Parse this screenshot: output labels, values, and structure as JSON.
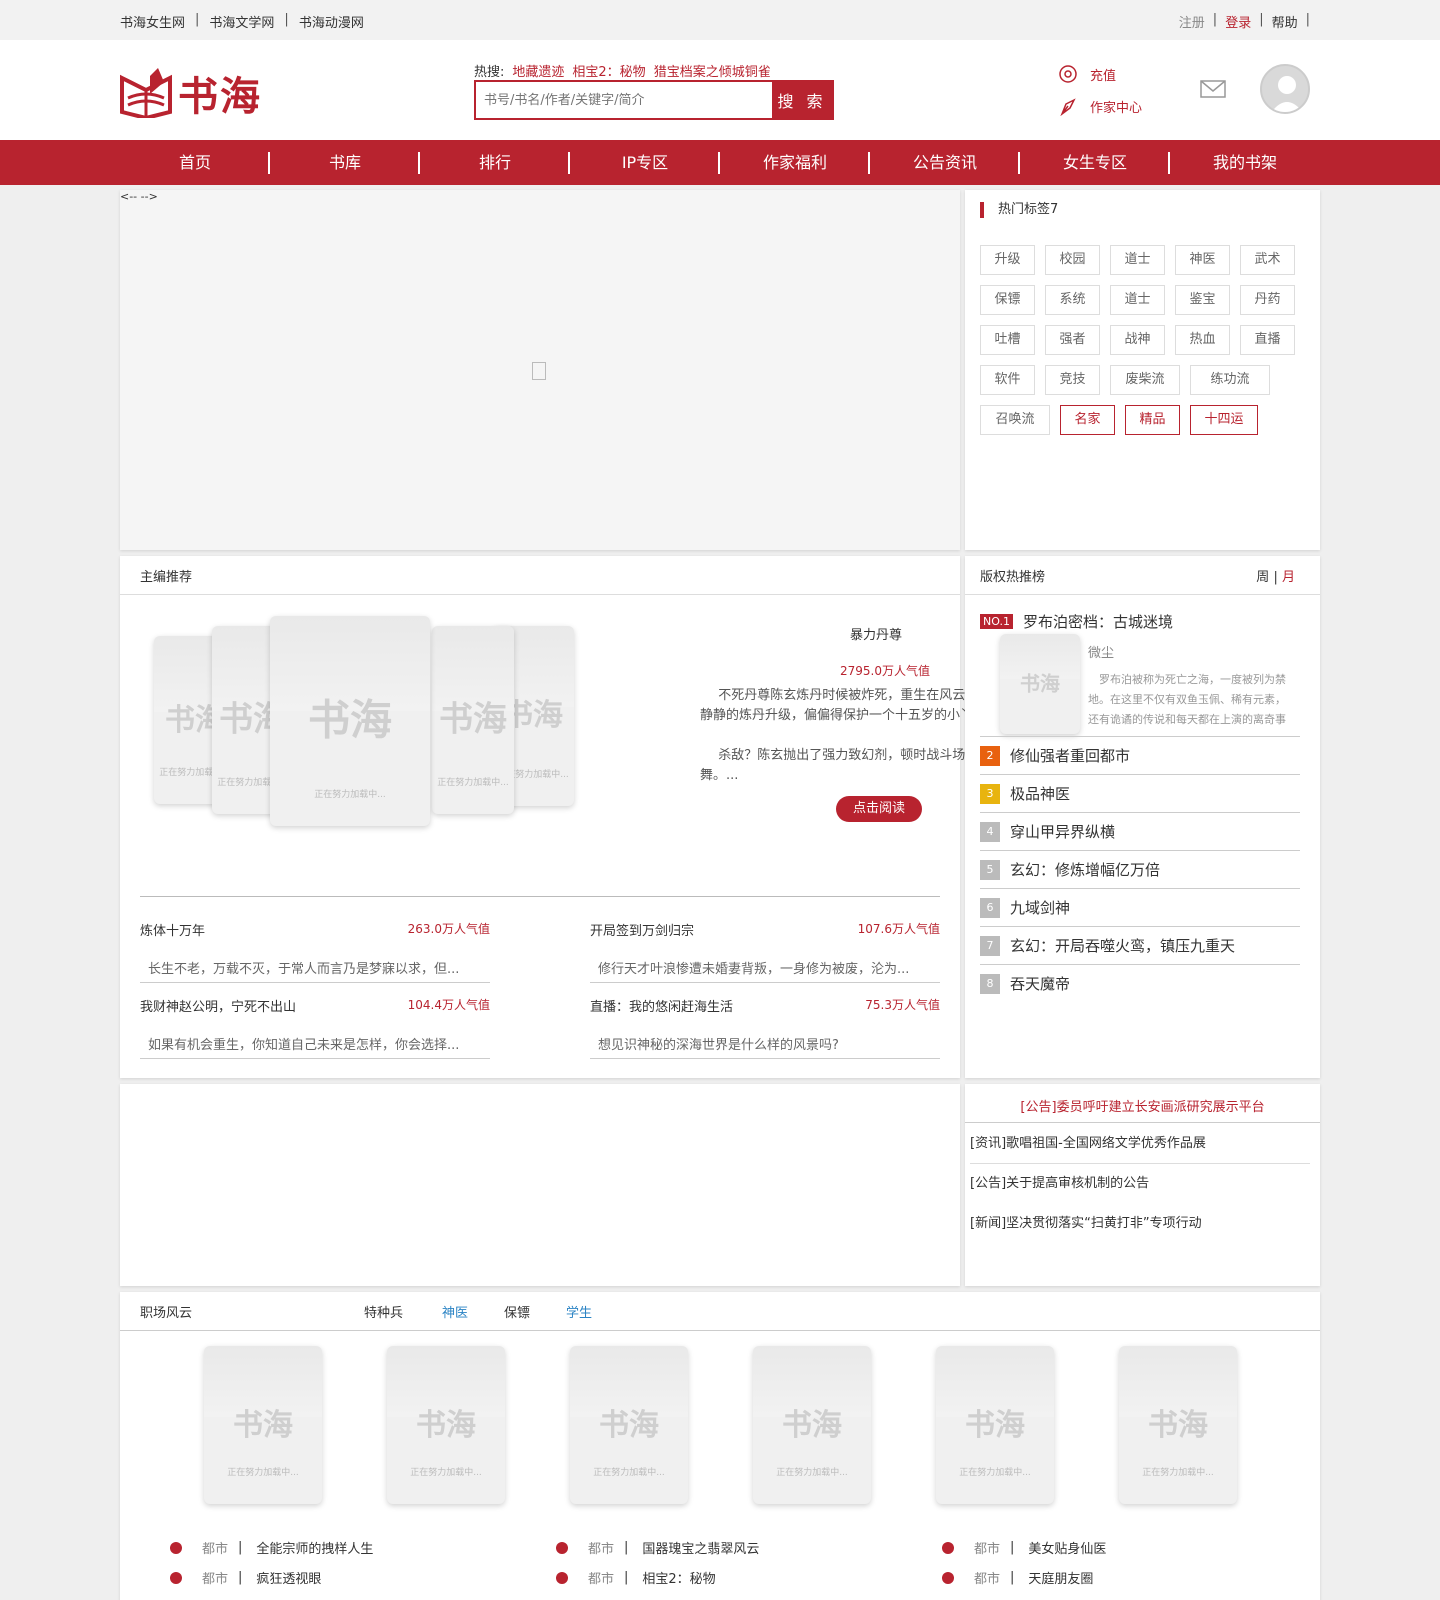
{
  "topbar": {
    "sites": [
      "书海女生网",
      "书海文学网",
      "书海动漫网"
    ],
    "register": "注册",
    "login": "登录",
    "help": "帮助"
  },
  "header": {
    "logo_text": "书海",
    "hot_label": "热搜:",
    "hot_keywords": [
      "地藏遗迹",
      "相宝2：秘物",
      "猎宝档案之倾城铜雀"
    ],
    "search_placeholder": "书号/书名/作者/关键字/简介",
    "search_button": "搜 索",
    "recharge": "充值",
    "author_center": "作家中心"
  },
  "nav": [
    "首页",
    "书库",
    "排行",
    "IP专区",
    "作家福利",
    "公告资讯",
    "女生专区",
    "我的书架"
  ],
  "banner": {
    "comment_text": "<-- -->"
  },
  "tags": {
    "title": "热门标签7",
    "items": [
      {
        "label": "升级",
        "hl": false
      },
      {
        "label": "校园",
        "hl": false
      },
      {
        "label": "道士",
        "hl": false
      },
      {
        "label": "神医",
        "hl": false
      },
      {
        "label": "武术",
        "hl": false
      },
      {
        "label": "保镖",
        "hl": false
      },
      {
        "label": "系统",
        "hl": false
      },
      {
        "label": "道士",
        "hl": false
      },
      {
        "label": "鉴宝",
        "hl": false
      },
      {
        "label": "丹药",
        "hl": false
      },
      {
        "label": "吐槽",
        "hl": false
      },
      {
        "label": "强者",
        "hl": false
      },
      {
        "label": "战神",
        "hl": false
      },
      {
        "label": "热血",
        "hl": false
      },
      {
        "label": "直播",
        "hl": false
      },
      {
        "label": "软件",
        "hl": false
      },
      {
        "label": "竞技",
        "hl": false
      },
      {
        "label": "废柴流",
        "hl": false
      },
      {
        "label": "练功流",
        "hl": false
      },
      {
        "label": "召唤流",
        "hl": false
      },
      {
        "label": "名家",
        "hl": true
      },
      {
        "label": "精品",
        "hl": true
      },
      {
        "label": "十四运",
        "hl": true
      }
    ]
  },
  "editor": {
    "title": "主编推荐",
    "cover_logo": "书海",
    "cover_loading": "正在努力加载中...",
    "featured": {
      "name": "暴力丹尊",
      "hot": "2795.0万人气值",
      "desc1": "不死丹尊陈玄炼丹时候被炸死，重生在风云大陆，本想安安静静的炼丹升级，偏偏得保护一个十五岁的小丫头。",
      "desc2": "杀敌？陈玄抛出了强力致幻剂，顿时战斗场面变得群魔乱舞。...",
      "read": "点击阅读"
    },
    "books": [
      {
        "title": "炼体十万年",
        "hot": "263.0万人气值",
        "desc": "长生不老，万载不灭，于常人而言乃是梦寐以求，但..."
      },
      {
        "title": "开局签到万剑归宗",
        "hot": "107.6万人气值",
        "desc": "修行天才叶浪惨遭未婚妻背叛，一身修为被废，沦为..."
      },
      {
        "title": "我财神赵公明，宁死不出山",
        "hot": "104.4万人气值",
        "desc": "如果有机会重生，你知道自己未来是怎样，你会选择..."
      },
      {
        "title": "直播：我的悠闲赶海生活",
        "hot": "75.3万人气值",
        "desc": "想见识神秘的深海世界是什么样的风景吗?"
      }
    ]
  },
  "rank": {
    "title": "版权热推榜",
    "week": "周",
    "sep": "|",
    "month": "月",
    "first": {
      "badge": "NO.1",
      "name": "罗布泊密档：古城迷境",
      "author": "微尘",
      "summary": "罗布泊被称为死亡之海，一度被列为禁地。在这里不仅有双鱼玉佩、稀有元素，还有诡谲的传说和每天都在上演的离奇事件。"
    },
    "items": [
      {
        "num": "2",
        "name": "修仙强者重回都市",
        "color": "#e8610f"
      },
      {
        "num": "3",
        "name": "极品神医",
        "color": "#e8b40f"
      },
      {
        "num": "4",
        "name": "穿山甲异界纵横",
        "color": "#bbbbbb"
      },
      {
        "num": "5",
        "name": "玄幻：修炼增幅亿万倍",
        "color": "#bbbbbb"
      },
      {
        "num": "6",
        "name": "九域剑神",
        "color": "#bbbbbb"
      },
      {
        "num": "7",
        "name": "玄幻：开局吞噬火鸾，镇压九重天",
        "color": "#bbbbbb"
      },
      {
        "num": "8",
        "name": "吞天魔帝",
        "color": "#bbbbbb"
      }
    ]
  },
  "news": {
    "headline": "[公告]委员呼吁建立长安画派研究展示平台",
    "items": [
      "[资讯]歌唱祖国-全国网络文学优秀作品展",
      "[公告]关于提高审核机制的公告",
      "[新闻]坚决贯彻落实“扫黄打非”专项行动"
    ]
  },
  "bottom": {
    "category": "职场风云",
    "tabs": [
      {
        "label": "特种兵",
        "blue": false
      },
      {
        "label": "神医",
        "blue": true
      },
      {
        "label": "保镖",
        "blue": false
      },
      {
        "label": "学生",
        "blue": true
      }
    ],
    "list": [
      {
        "genre": "都市",
        "sep": "|",
        "title": "全能宗师的拽样人生"
      },
      {
        "genre": "都市",
        "sep": "|",
        "title": "国器瑰宝之翡翠风云"
      },
      {
        "genre": "都市",
        "sep": "|",
        "title": "美女贴身仙医"
      },
      {
        "genre": "都市",
        "sep": "|",
        "title": "疯狂透视眼"
      },
      {
        "genre": "都市",
        "sep": "|",
        "title": "相宝2：秘物"
      },
      {
        "genre": "都市",
        "sep": "|",
        "title": "天庭朋友圈"
      }
    ]
  }
}
